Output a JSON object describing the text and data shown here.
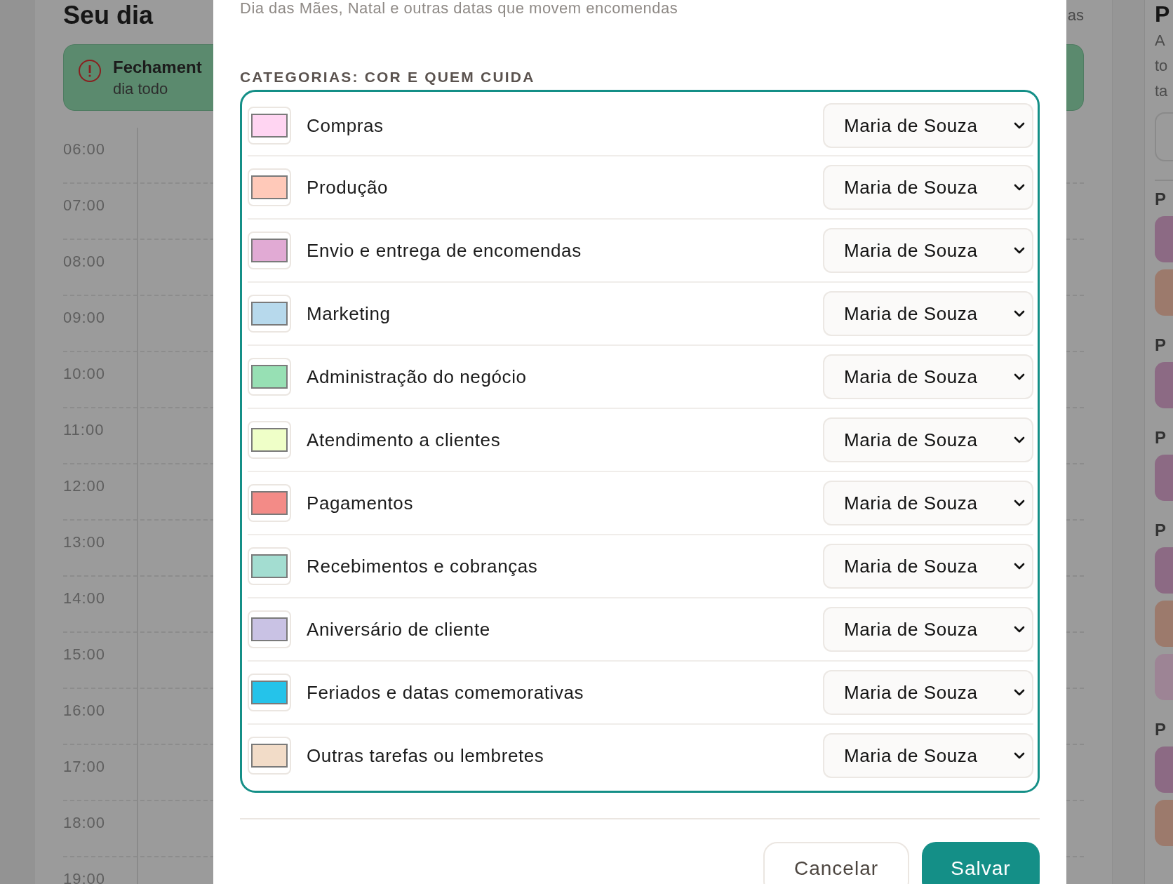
{
  "day_view": {
    "title": "Seu dia",
    "title_end": "as",
    "all_day_event": {
      "title": "Fechament",
      "time": "dia todo"
    },
    "hours": [
      "06:00",
      "07:00",
      "08:00",
      "09:00",
      "10:00",
      "11:00",
      "12:00",
      "13:00",
      "14:00",
      "15:00",
      "16:00",
      "17:00",
      "18:00",
      "19:00"
    ]
  },
  "side_panel": {
    "title": "P",
    "lines": [
      "A",
      "to",
      "ta"
    ],
    "sections": [
      {
        "heading": "P",
        "cards": [
          {
            "color": "#8c6a84"
          },
          {
            "color": "#9c7a6c"
          }
        ]
      },
      {
        "heading": "P",
        "cards": [
          {
            "color": "#8c6a84"
          }
        ]
      },
      {
        "heading": "P",
        "cards": [
          {
            "color": "#8c6a84"
          }
        ]
      },
      {
        "heading": "P",
        "cards": [
          {
            "color": "#8c6a84"
          },
          {
            "color": "#9c7a6c"
          },
          {
            "color": "#9d8495"
          }
        ]
      },
      {
        "heading": "P",
        "cards": [
          {
            "color": "#8c6a84"
          },
          {
            "color": "#9c7a6c"
          }
        ]
      }
    ]
  },
  "dialog": {
    "subtitle": "Dia das Mães, Natal e outras datas que movem encomendas",
    "section_heading": "CATEGORIAS: COR E QUEM CUIDA",
    "categories": [
      {
        "name": "Compras",
        "color": "#ffd5f2",
        "owner": "Maria de Souza"
      },
      {
        "name": "Produção",
        "color": "#ffc9b9",
        "owner": "Maria de Souza"
      },
      {
        "name": "Envio e entrega de encomendas",
        "color": "#e1aad4",
        "owner": "Maria de Souza"
      },
      {
        "name": "Marketing",
        "color": "#b7d9ec",
        "owner": "Maria de Souza"
      },
      {
        "name": "Administração do negócio",
        "color": "#97e0b4",
        "owner": "Maria de Souza"
      },
      {
        "name": "Atendimento a clientes",
        "color": "#efffc8",
        "owner": "Maria de Souza"
      },
      {
        "name": "Pagamentos",
        "color": "#f38b87",
        "owner": "Maria de Souza"
      },
      {
        "name": "Recebimentos e cobranças",
        "color": "#a3ddd1",
        "owner": "Maria de Souza"
      },
      {
        "name": "Aniversário de cliente",
        "color": "#c9c2e4",
        "owner": "Maria de Souza"
      },
      {
        "name": "Feriados e datas comemorativas",
        "color": "#25c3ea",
        "owner": "Maria de Souza"
      },
      {
        "name": "Outras tarefas ou lembretes",
        "color": "#f2dcc8",
        "owner": "Maria de Souza"
      }
    ],
    "buttons": {
      "cancel": "Cancelar",
      "save": "Salvar"
    }
  }
}
